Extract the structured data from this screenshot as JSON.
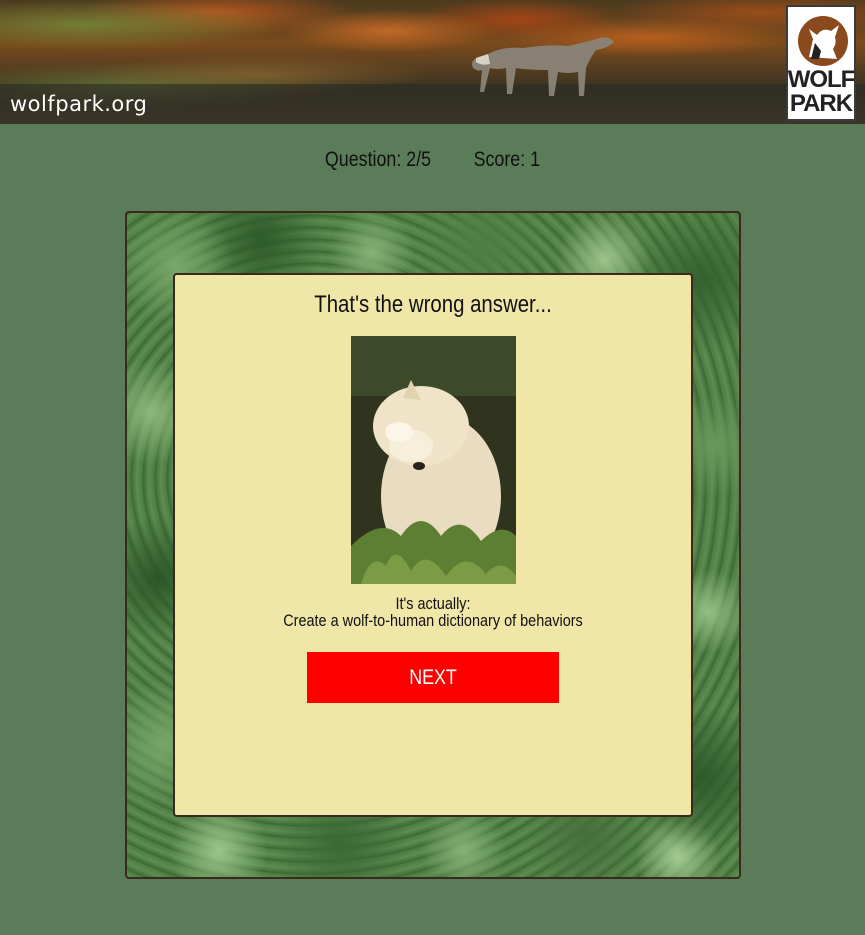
{
  "header": {
    "site_url": "wolfpark.org",
    "logo_line1": "WOLF",
    "logo_line2": "PARK"
  },
  "status": {
    "question": "Question: 2/5",
    "score": "Score: 1"
  },
  "result": {
    "title": "That's the wrong answer...",
    "answer_label": "It's actually:",
    "answer_text": "Create a wolf-to-human dictionary of behaviors",
    "next_label": "NEXT"
  },
  "colors": {
    "page_background": "#5a7c58",
    "card_background": "#f0e6a8",
    "next_button": "#ff0000",
    "frame_border": "#3b2a1a"
  }
}
